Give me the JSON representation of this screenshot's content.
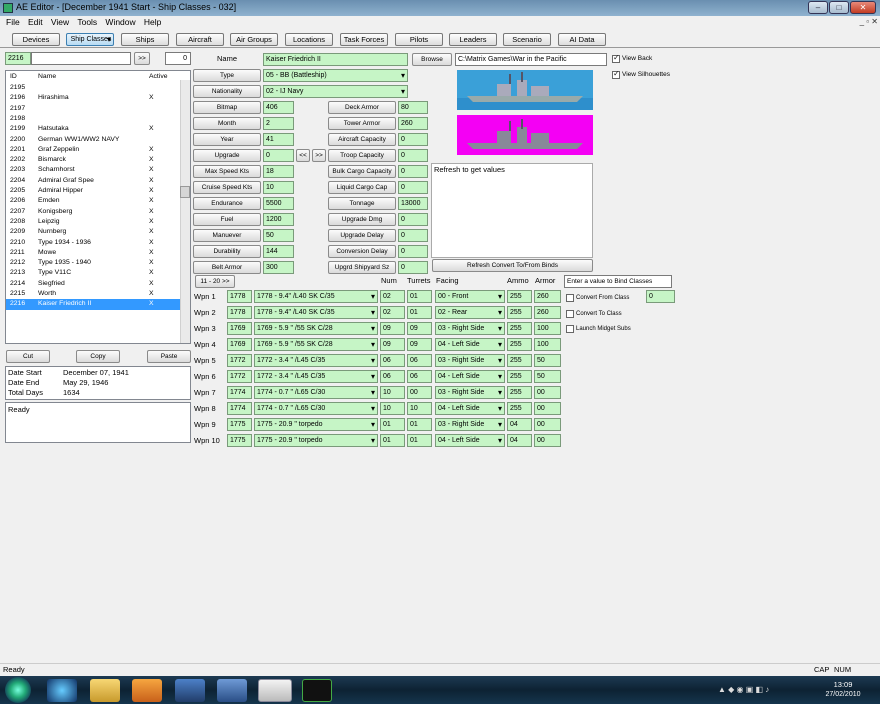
{
  "window": {
    "title": "AE Editor - [December 1941 Start - Ship Classes - 032]"
  },
  "menu": [
    "File",
    "Edit",
    "View",
    "Tools",
    "Window",
    "Help"
  ],
  "tabs": [
    {
      "label": "Devices"
    },
    {
      "label": "Ship Classes"
    },
    {
      "label": "Ships"
    },
    {
      "label": "Aircraft"
    },
    {
      "label": "Air Groups"
    },
    {
      "label": "Locations"
    },
    {
      "label": "Task Forces"
    },
    {
      "label": "Pilots"
    },
    {
      "label": "Leaders"
    },
    {
      "label": "Scenario"
    },
    {
      "label": "AI Data"
    }
  ],
  "search": {
    "id_value": "2216",
    "text_value": "",
    "go_label": ">>",
    "count": "0"
  },
  "list": {
    "headers": {
      "id": "ID",
      "name": "Name",
      "active": "Active"
    },
    "rows": [
      {
        "id": "2195",
        "name": "",
        "active": ""
      },
      {
        "id": "2196",
        "name": "Hirashima",
        "active": "X"
      },
      {
        "id": "2197",
        "name": "",
        "active": ""
      },
      {
        "id": "2198",
        "name": "",
        "active": ""
      },
      {
        "id": "2199",
        "name": "Hatsutaka",
        "active": "X"
      },
      {
        "id": "2200",
        "name": "German WW1/WW2 NAVY",
        "active": ""
      },
      {
        "id": "2201",
        "name": "Graf Zeppelin",
        "active": "X"
      },
      {
        "id": "2202",
        "name": "Bismarck",
        "active": "X"
      },
      {
        "id": "2203",
        "name": "Scharnhorst",
        "active": "X"
      },
      {
        "id": "2204",
        "name": "Admiral Graf Spee",
        "active": "X"
      },
      {
        "id": "2205",
        "name": "Admiral Hipper",
        "active": "X"
      },
      {
        "id": "2206",
        "name": "Emden",
        "active": "X"
      },
      {
        "id": "2207",
        "name": "Konigsberg",
        "active": "X"
      },
      {
        "id": "2208",
        "name": "Leipzig",
        "active": "X"
      },
      {
        "id": "2209",
        "name": "Nurnberg",
        "active": "X"
      },
      {
        "id": "2210",
        "name": "Type 1934 - 1936",
        "active": "X"
      },
      {
        "id": "2211",
        "name": "Mowe",
        "active": "X"
      },
      {
        "id": "2212",
        "name": "Type 1935 - 1940",
        "active": "X"
      },
      {
        "id": "2213",
        "name": "Type V11C",
        "active": "X"
      },
      {
        "id": "2214",
        "name": "Siegfried",
        "active": "X"
      },
      {
        "id": "2215",
        "name": "Worth",
        "active": "X"
      },
      {
        "id": "2216",
        "name": "Kaiser Friedrich II",
        "active": "X"
      }
    ]
  },
  "clip": {
    "cut": "Cut",
    "copy": "Copy",
    "paste": "Paste"
  },
  "dates": {
    "start_label": "Date Start",
    "start": "December 07, 1941",
    "end_label": "Date End",
    "end": "May 29, 1946",
    "total_label": "Total Days",
    "total": "1634"
  },
  "status_box": "Ready",
  "form": {
    "name_label": "Name",
    "name": "Kaiser Friedrich II",
    "browse": "Browse",
    "path": "C:\\Matrix Games\\War in the Pacific",
    "view_back": "View Back",
    "view_silhouettes": "View Silhouettes",
    "type_label": "Type",
    "type": "05 - BB (Battleship)",
    "nationality_label": "Nationality",
    "nationality": "02 - IJ Navy",
    "left_fields": [
      {
        "label": "Bitmap",
        "value": "406"
      },
      {
        "label": "Month",
        "value": "2"
      },
      {
        "label": "Year",
        "value": "41"
      },
      {
        "label": "Upgrade",
        "value": "0"
      },
      {
        "label": "Max Speed Kts",
        "value": "18"
      },
      {
        "label": "Cruise Speed Kts",
        "value": "10"
      },
      {
        "label": "Endurance",
        "value": "5500"
      },
      {
        "label": "Fuel",
        "value": "1200"
      },
      {
        "label": "Manuever",
        "value": "50"
      },
      {
        "label": "Durability",
        "value": "144"
      },
      {
        "label": "Belt Armor",
        "value": "300"
      }
    ],
    "prev": "<<",
    "next": ">>",
    "right_fields": [
      {
        "label": "Deck Armor",
        "value": "80"
      },
      {
        "label": "Tower Armor",
        "value": "260"
      },
      {
        "label": "Aircraft Capacity",
        "value": "0"
      },
      {
        "label": "Troop Capacity",
        "value": "0"
      },
      {
        "label": "Bulk Cargo Capacity",
        "value": "0"
      },
      {
        "label": "Liquid Cargo Cap",
        "value": "0"
      },
      {
        "label": "Tonnage",
        "value": "13000"
      },
      {
        "label": "Upgrade Dmg",
        "value": "0"
      },
      {
        "label": "Upgrade Delay",
        "value": "0"
      },
      {
        "label": "Conversion Delay",
        "value": "0"
      },
      {
        "label": "Upgrd Shipyard Sz",
        "value": "0"
      }
    ],
    "refresh_text": "Refresh to get values",
    "refresh_convert": "Refresh Convert To/From Binds",
    "bind_label": "Enter a value to Bind Classes",
    "convert_from": "Convert From Class",
    "convert_from_value": "0",
    "convert_to": "Convert To Class",
    "launch_midget": "Launch Midget Subs",
    "wpn_page": "11 - 20 >>",
    "wpn_headers": {
      "num": "Num",
      "turrets": "Turrets",
      "facing": "Facing",
      "ammo": "Ammo",
      "armor": "Armor"
    }
  },
  "weapons": [
    {
      "label": "Wpn 1",
      "id": "1778",
      "name": "1778 - 9.4\" /L40 SK C/35",
      "num": "02",
      "turrets": "01",
      "facing": "00 - Front",
      "ammo": "255",
      "armor": "260"
    },
    {
      "label": "Wpn 2",
      "id": "1778",
      "name": "1778 - 9.4\" /L40 SK C/35",
      "num": "02",
      "turrets": "01",
      "facing": "02 - Rear",
      "ammo": "255",
      "armor": "260"
    },
    {
      "label": "Wpn 3",
      "id": "1769",
      "name": "1769 - 5.9 \" /55 SK C/28",
      "num": "09",
      "turrets": "09",
      "facing": "03 - Right Side",
      "ammo": "255",
      "armor": "100"
    },
    {
      "label": "Wpn 4",
      "id": "1769",
      "name": "1769 - 5.9 \" /55 SK C/28",
      "num": "09",
      "turrets": "09",
      "facing": "04 - Left Side",
      "ammo": "255",
      "armor": "100"
    },
    {
      "label": "Wpn 5",
      "id": "1772",
      "name": "1772 - 3.4 \" /L45 C/35",
      "num": "06",
      "turrets": "06",
      "facing": "03 - Right Side",
      "ammo": "255",
      "armor": "50"
    },
    {
      "label": "Wpn 6",
      "id": "1772",
      "name": "1772 - 3.4 \" /L45 C/35",
      "num": "06",
      "turrets": "06",
      "facing": "04 - Left Side",
      "ammo": "255",
      "armor": "50"
    },
    {
      "label": "Wpn 7",
      "id": "1774",
      "name": "1774 - 0.7 \" /L65 C/30",
      "num": "10",
      "turrets": "00",
      "facing": "03 - Right Side",
      "ammo": "255",
      "armor": "00"
    },
    {
      "label": "Wpn 8",
      "id": "1774",
      "name": "1774 - 0.7 \" /L65 C/30",
      "num": "10",
      "turrets": "10",
      "facing": "04 - Left Side",
      "ammo": "255",
      "armor": "00"
    },
    {
      "label": "Wpn 9",
      "id": "1775",
      "name": "1775 - 20.9 \" torpedo",
      "num": "01",
      "turrets": "01",
      "facing": "03 - Right Side",
      "ammo": "04",
      "armor": "00"
    },
    {
      "label": "Wpn 10",
      "id": "1775",
      "name": "1775 - 20.9 \" torpedo",
      "num": "01",
      "turrets": "01",
      "facing": "04 - Left Side",
      "ammo": "04",
      "armor": "00"
    }
  ],
  "statusbar": {
    "left": "Ready",
    "caps": "CAP",
    "num": "NUM"
  },
  "clock": {
    "time": "13:09",
    "date": "27/02/2010"
  }
}
